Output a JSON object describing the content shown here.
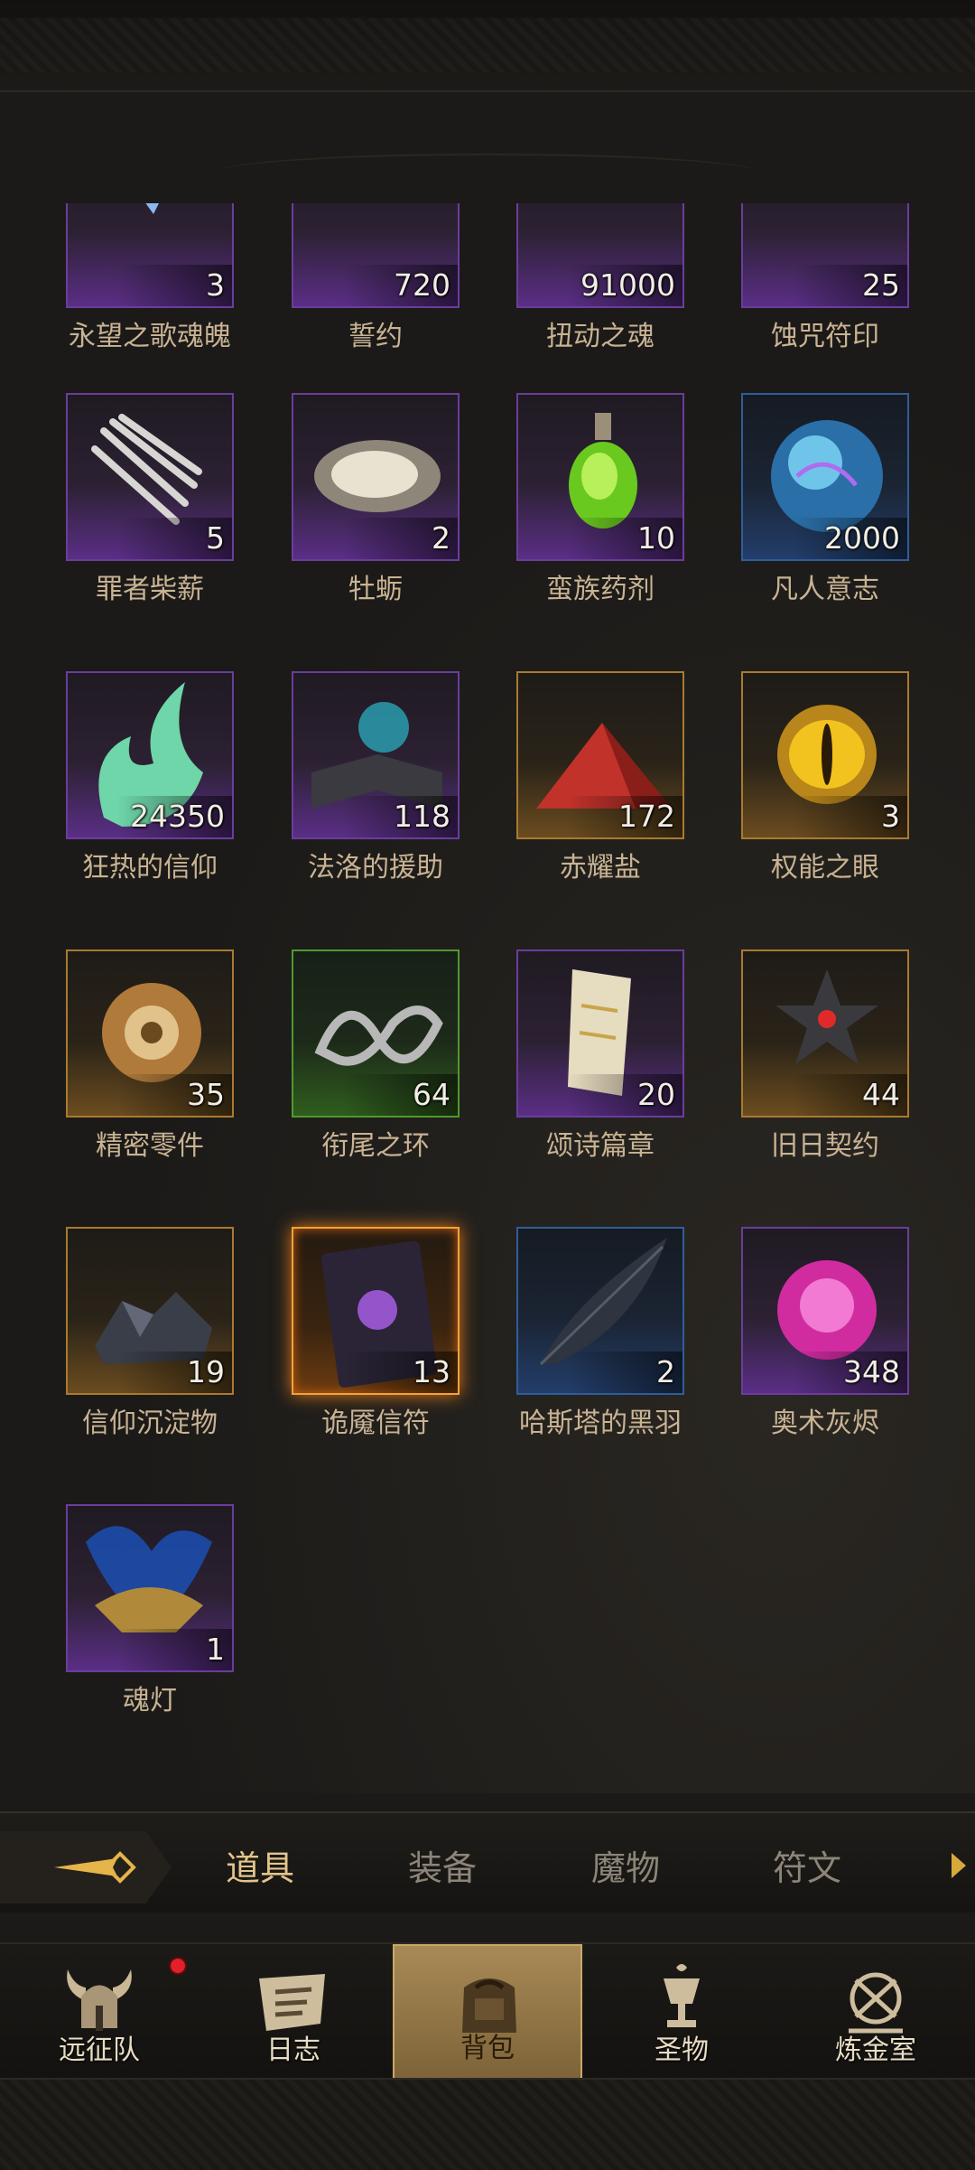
{
  "items": [
    {
      "name": "永望之歌魂魄",
      "count": "3",
      "rarity": "purple",
      "icon": "blue-crystal-icon"
    },
    {
      "name": "誓约",
      "count": "720",
      "rarity": "purple",
      "icon": "sun-medal-icon"
    },
    {
      "name": "扭动之魂",
      "count": "91000",
      "rarity": "purple",
      "icon": "blue-wisp-icon"
    },
    {
      "name": "蚀咒符印",
      "count": "25",
      "rarity": "purple",
      "icon": "green-gem-icon"
    },
    {
      "name": "罪者柴薪",
      "count": "5",
      "rarity": "purple",
      "icon": "bone-kindling-icon"
    },
    {
      "name": "牡蛎",
      "count": "2",
      "rarity": "purple",
      "icon": "oyster-icon"
    },
    {
      "name": "蛮族药剂",
      "count": "10",
      "rarity": "purple",
      "icon": "green-potion-icon"
    },
    {
      "name": "凡人意志",
      "count": "2000",
      "rarity": "blue",
      "icon": "blue-orb-icon"
    },
    {
      "name": "狂热的信仰",
      "count": "24350",
      "rarity": "purple",
      "icon": "green-flame-icon"
    },
    {
      "name": "法洛的援助",
      "count": "118",
      "rarity": "purple",
      "icon": "open-book-icon"
    },
    {
      "name": "赤耀盐",
      "count": "172",
      "rarity": "gold",
      "icon": "red-salt-icon"
    },
    {
      "name": "权能之眼",
      "count": "3",
      "rarity": "gold",
      "icon": "golden-eye-icon"
    },
    {
      "name": "精密零件",
      "count": "35",
      "rarity": "gold",
      "icon": "gear-icon"
    },
    {
      "name": "衔尾之环",
      "count": "64",
      "rarity": "green",
      "icon": "infinity-ring-icon"
    },
    {
      "name": "颂诗篇章",
      "count": "20",
      "rarity": "purple",
      "icon": "parchment-icon"
    },
    {
      "name": "旧日契约",
      "count": "44",
      "rarity": "gold",
      "icon": "dark-star-key-icon"
    },
    {
      "name": "信仰沉淀物",
      "count": "19",
      "rarity": "gold",
      "icon": "coal-rocks-icon"
    },
    {
      "name": "诡魇信符",
      "count": "13",
      "rarity": "orange",
      "icon": "nightmare-card-icon"
    },
    {
      "name": "哈斯塔的黑羽",
      "count": "2",
      "rarity": "blue",
      "icon": "black-feather-icon"
    },
    {
      "name": "奥术灰烬",
      "count": "348",
      "rarity": "purple",
      "icon": "pink-arcane-icon"
    },
    {
      "name": "魂灯",
      "count": "1",
      "rarity": "purple",
      "icon": "magic-lamp-icon"
    }
  ],
  "tabs": {
    "back_icon": "back-arrow-icon",
    "items": [
      {
        "label": "道具",
        "active": true
      },
      {
        "label": "装备",
        "active": false
      },
      {
        "label": "魔物",
        "active": false
      },
      {
        "label": "符文",
        "active": false
      }
    ]
  },
  "nav": [
    {
      "label": "远征队",
      "icon": "horned-helmet-icon",
      "badge": true,
      "active": false
    },
    {
      "label": "日志",
      "icon": "scroll-icon",
      "badge": false,
      "active": false
    },
    {
      "label": "背包",
      "icon": "backpack-icon",
      "badge": false,
      "active": true
    },
    {
      "label": "圣物",
      "icon": "chalice-icon",
      "badge": false,
      "active": false
    },
    {
      "label": "炼金室",
      "icon": "alchemy-icon",
      "badge": false,
      "active": false
    }
  ],
  "colors": {
    "purple": "#6a3d9c",
    "gold": "#a97a2f",
    "green": "#4e9a2f",
    "blue": "#2f5d9a",
    "orange": "#f2a23a",
    "active_tab": "#e3c48b",
    "badge": "#e0202a"
  }
}
